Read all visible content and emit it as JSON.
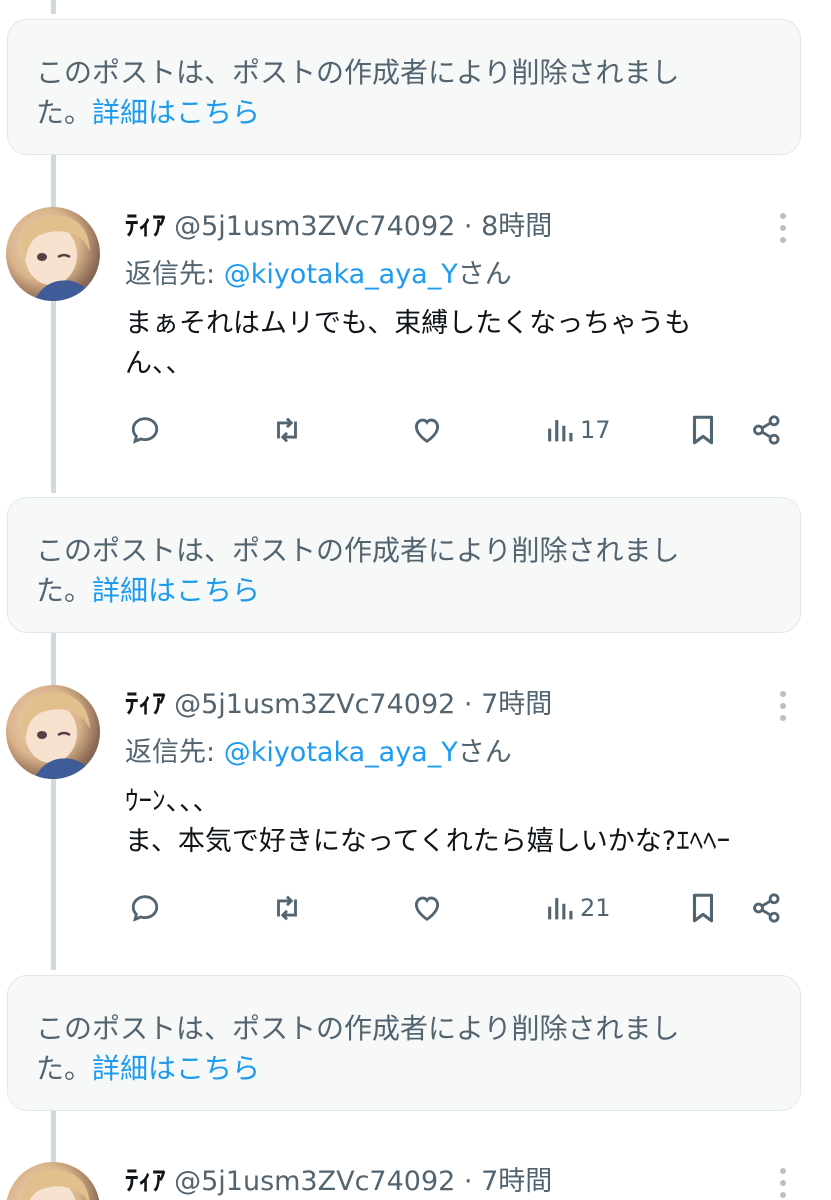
{
  "deleted_notice": {
    "text": "このポストは、ポストの作成者により削除されまし",
    "text_line2": "た。",
    "link": "詳細はこちら"
  },
  "posts": [
    {
      "name": "ﾃｨｱ",
      "handle": "@5j1usm3ZVc74092",
      "separator": "·",
      "time": "8時間",
      "reply_prefix": "返信先: ",
      "reply_handle": "@kiyotaka_aya_Y",
      "reply_suffix": "さん",
      "body_line1": "まぁそれはムリでも、束縛したくなっちゃうも",
      "body_line2": "ん、、",
      "views": "17"
    },
    {
      "name": "ﾃｨｱ",
      "handle": "@5j1usm3ZVc74092",
      "separator": "·",
      "time": "7時間",
      "reply_prefix": "返信先: ",
      "reply_handle": "@kiyotaka_aya_Y",
      "reply_suffix": "さん",
      "body_line1": "ｳｰﾝ、、、",
      "body_line2": "ま、本気で好きになってくれたら嬉しいかな?ｴﾍﾍｰ",
      "views": "21"
    },
    {
      "name": "ﾃｨｱ",
      "handle": "@5j1usm3ZVc74092",
      "separator": "·",
      "time": "7時間"
    }
  ],
  "colors": {
    "accent": "#1d9bf0",
    "muted": "#536471",
    "thread_line": "#cfd9de",
    "deleted_bg": "#f7f9f9"
  },
  "icons": [
    "reply-icon",
    "repost-icon",
    "like-icon",
    "views-icon",
    "bookmark-icon",
    "share-icon",
    "more-icon"
  ]
}
